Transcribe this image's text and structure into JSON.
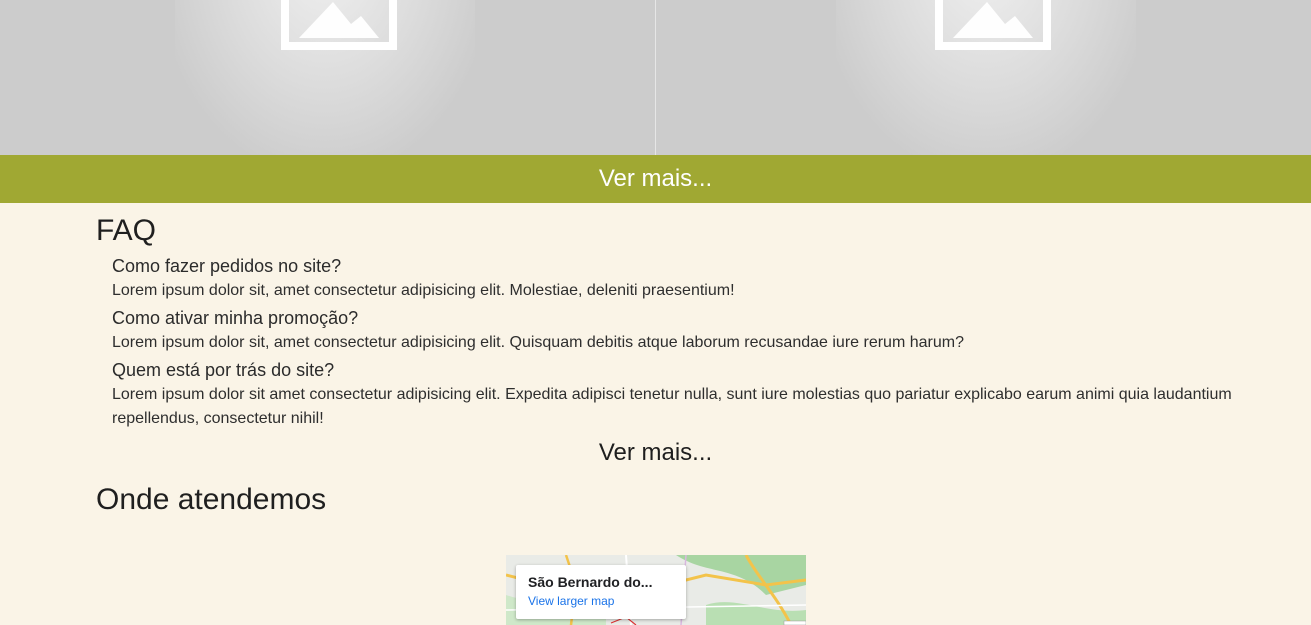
{
  "gallery": {
    "images": [
      {
        "icon": "image-placeholder-icon"
      },
      {
        "icon": "image-placeholder-icon"
      }
    ],
    "ver_mais_label": "Ver mais..."
  },
  "faq": {
    "title": "FAQ",
    "items": [
      {
        "question": "Como fazer pedidos no site?",
        "answer": "Lorem ipsum dolor sit, amet consectetur adipisicing elit. Molestiae, deleniti praesentium!"
      },
      {
        "question": "Como ativar minha promoção?",
        "answer": "Lorem ipsum dolor sit, amet consectetur adipisicing elit. Quisquam debitis atque laborum recusandae iure rerum harum?"
      },
      {
        "question": "Quem está por trás do site?",
        "answer": "Lorem ipsum dolor sit amet consectetur adipisicing elit. Expedita adipisci tenetur nulla, sunt iure molestias quo pariatur explicabo earum animi quia laudantium repellendus, consectetur nihil!"
      }
    ],
    "ver_mais_label": "Ver mais..."
  },
  "locations": {
    "title": "Onde atendemos",
    "map": {
      "place_name": "São Bernardo do...",
      "link_label": "View larger map"
    }
  },
  "colors": {
    "background": "#faf4e7",
    "accent_bar": "#a0a833"
  }
}
